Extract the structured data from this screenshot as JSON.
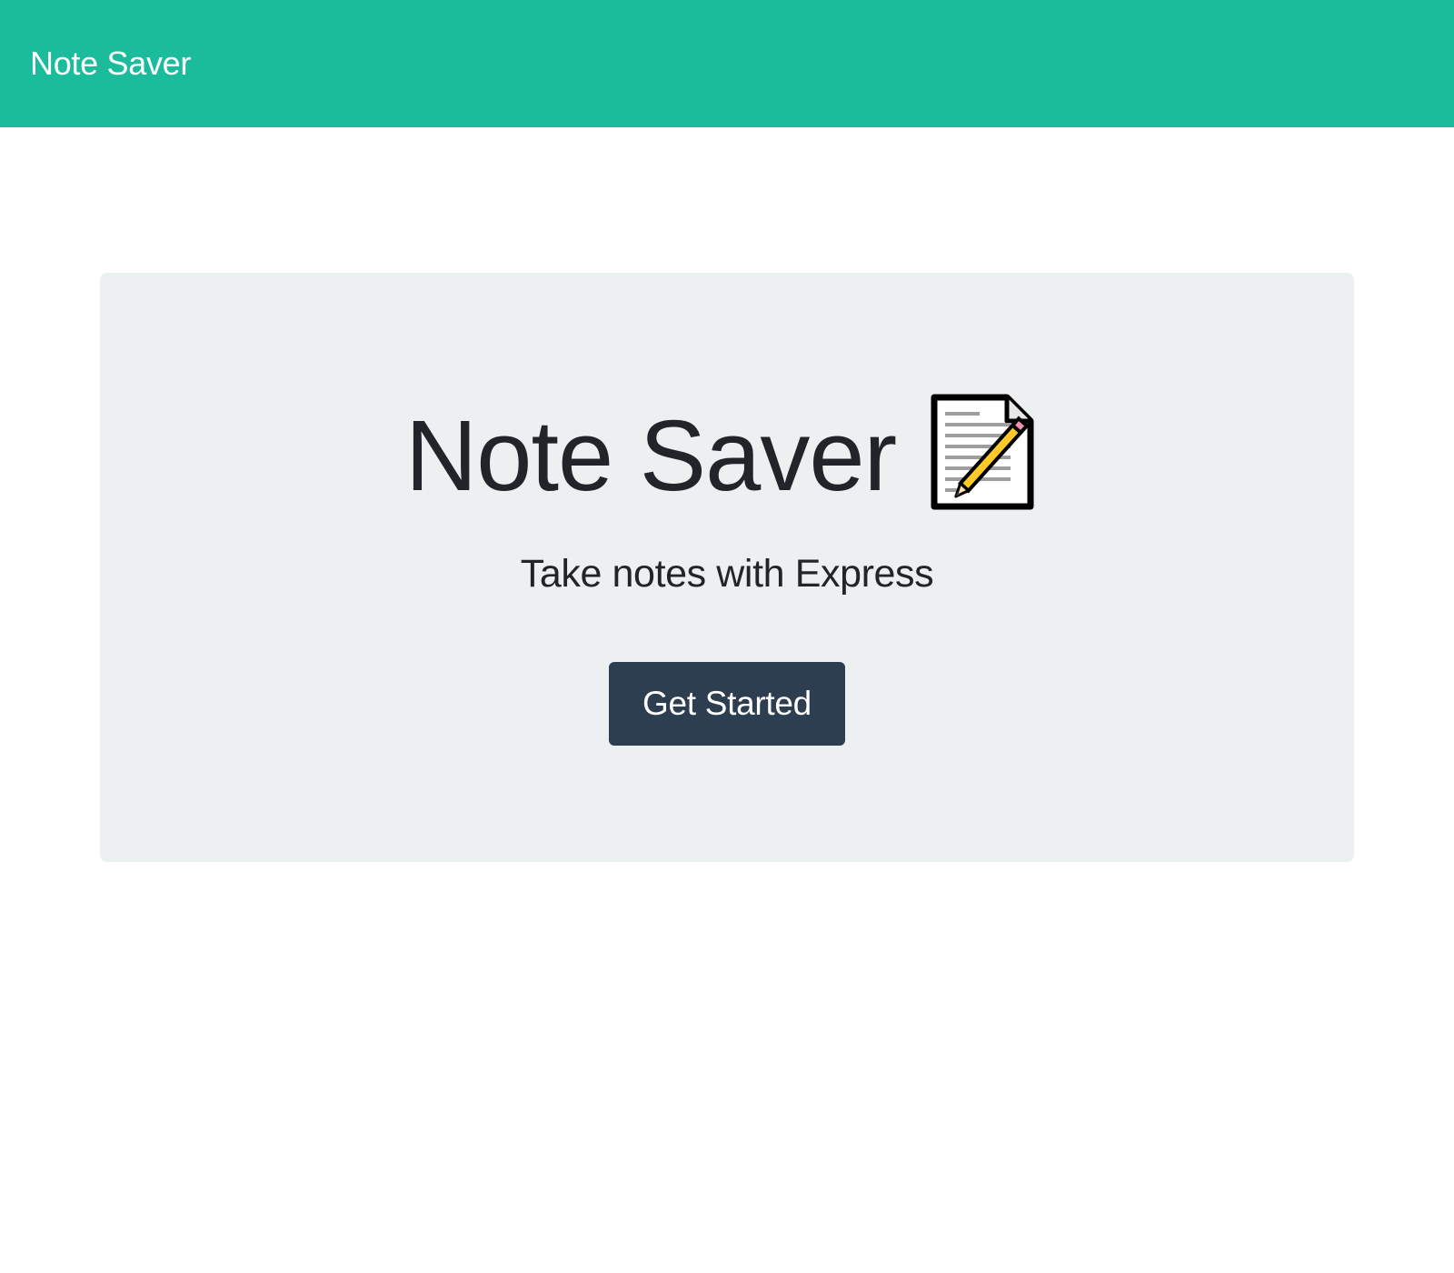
{
  "navbar": {
    "brand": "Note Saver"
  },
  "hero": {
    "title": "Note Saver",
    "icon": "memo-icon",
    "subtitle": "Take notes with Express",
    "cta_label": "Get Started"
  },
  "colors": {
    "navbar_bg": "#1abc9c",
    "jumbotron_bg": "#ecf0f1",
    "button_bg": "#2c3e50",
    "text_dark": "#212529",
    "text_light": "#ffffff"
  }
}
